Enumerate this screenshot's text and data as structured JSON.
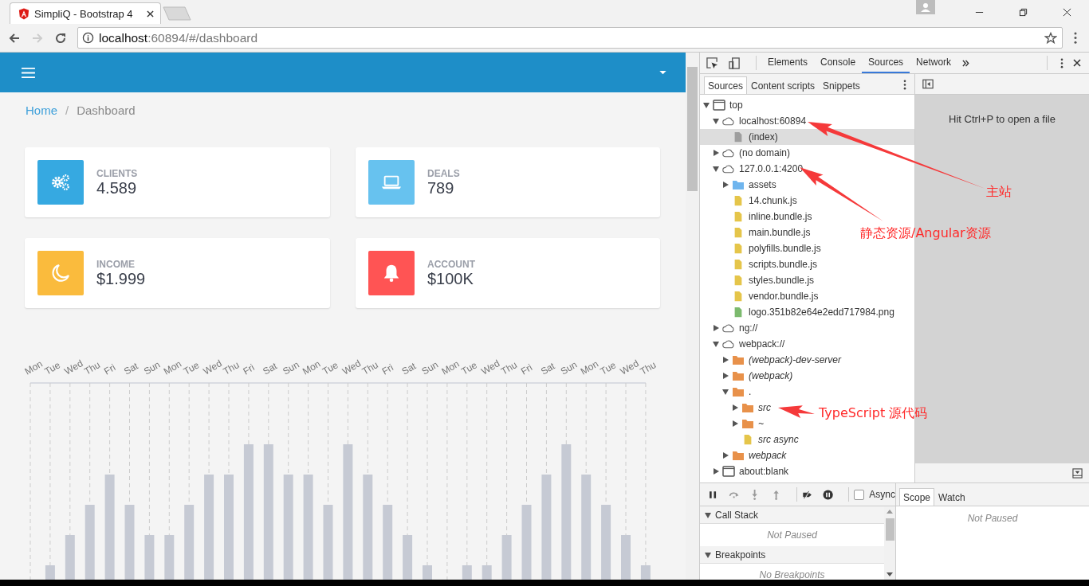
{
  "browser": {
    "tab": {
      "title": "SimpliQ - Bootstrap 4"
    },
    "address": {
      "host": "localhost",
      "rest": ":60894/#/dashboard"
    }
  },
  "page": {
    "breadcrumb": [
      {
        "label": "Home",
        "kind": "link"
      },
      {
        "label": "Dashboard",
        "kind": "current"
      }
    ],
    "breadcrumb_separator": "/",
    "stats": [
      {
        "label": "CLIENTS",
        "value": "4.589",
        "color": "#36a9e1",
        "kind": "gears"
      },
      {
        "label": "DEALS",
        "value": "789",
        "color": "#67c2ef",
        "kind": "laptop"
      },
      {
        "label": "INCOME",
        "value": "$1.999",
        "color": "#fabb3d",
        "kind": "moon"
      },
      {
        "label": "ACCOUNT",
        "value": "$100K",
        "color": "#ff5454",
        "kind": "bell"
      }
    ],
    "chart_labels": [
      "Mon",
      "Tue",
      "Wed",
      "Thu",
      "Fri",
      "Sat",
      "Sun",
      "Mon",
      "Tue",
      "Wed",
      "Thu",
      "Fri",
      "Sat",
      "Sun",
      "Mon",
      "Tue",
      "Wed",
      "Thu",
      "Fri",
      "Sat",
      "Sun",
      "Mon",
      "Tue",
      "Wed",
      "Thu",
      "Fri",
      "Sat",
      "Sun",
      "Mon",
      "Tue",
      "Wed",
      "Thu"
    ]
  },
  "devtools": {
    "tabs": [
      {
        "label": "Elements",
        "selected": false
      },
      {
        "label": "Console",
        "selected": false
      },
      {
        "label": "Sources",
        "selected": true
      },
      {
        "label": "Network",
        "selected": false
      }
    ],
    "navigator_tabs": [
      {
        "label": "Sources",
        "selected": true
      },
      {
        "label": "Content scripts",
        "selected": false
      },
      {
        "label": "Snippets",
        "selected": false
      }
    ],
    "tree": [
      {
        "label": "top",
        "kind": "frame",
        "expanded": true,
        "selected": false,
        "italic": false,
        "children": [
          {
            "label": "localhost:60894",
            "kind": "domain",
            "expanded": true,
            "selected": false,
            "italic": false,
            "children": [
              {
                "label": "(index)",
                "kind": "file",
                "color": "#9e9e9e",
                "selected": true,
                "italic": false
              }
            ]
          },
          {
            "label": "(no domain)",
            "kind": "domain",
            "expanded": false,
            "selected": false,
            "italic": false
          },
          {
            "label": "127.0.0.1:4200",
            "kind": "domain",
            "expanded": true,
            "selected": false,
            "italic": false,
            "children": [
              {
                "label": "assets",
                "kind": "folder",
                "color": "#6fb5ee",
                "expanded": false,
                "selected": false,
                "italic": false
              },
              {
                "label": "14.chunk.js",
                "kind": "file",
                "color": "#e5c54a",
                "selected": false,
                "italic": false
              },
              {
                "label": "inline.bundle.js",
                "kind": "file",
                "color": "#e5c54a",
                "selected": false,
                "italic": false
              },
              {
                "label": "main.bundle.js",
                "kind": "file",
                "color": "#e5c54a",
                "selected": false,
                "italic": false
              },
              {
                "label": "polyfills.bundle.js",
                "kind": "file",
                "color": "#e5c54a",
                "selected": false,
                "italic": false
              },
              {
                "label": "scripts.bundle.js",
                "kind": "file",
                "color": "#e5c54a",
                "selected": false,
                "italic": false
              },
              {
                "label": "styles.bundle.js",
                "kind": "file",
                "color": "#e5c54a",
                "selected": false,
                "italic": false
              },
              {
                "label": "vendor.bundle.js",
                "kind": "file",
                "color": "#e5c54a",
                "selected": false,
                "italic": false
              },
              {
                "label": "logo.351b82e64e2edd717984.png",
                "kind": "file",
                "color": "#7cba6e",
                "selected": false,
                "italic": false
              }
            ]
          },
          {
            "label": "ng://",
            "kind": "domain",
            "expanded": false,
            "selected": false,
            "italic": false
          },
          {
            "label": "webpack://",
            "kind": "domain",
            "expanded": true,
            "selected": false,
            "italic": false,
            "children": [
              {
                "label": "(webpack)-dev-server",
                "kind": "folder",
                "color": "#e8914a",
                "expanded": false,
                "selected": false,
                "italic": true
              },
              {
                "label": "(webpack)",
                "kind": "folder",
                "color": "#e8914a",
                "expanded": false,
                "selected": false,
                "italic": true
              },
              {
                "label": ".",
                "kind": "folder",
                "color": "#e8914a",
                "expanded": true,
                "selected": false,
                "italic": false,
                "children": [
                  {
                    "label": "src",
                    "kind": "folder",
                    "color": "#e8914a",
                    "expanded": false,
                    "selected": false,
                    "italic": true
                  },
                  {
                    "label": "~",
                    "kind": "folder",
                    "color": "#e8914a",
                    "expanded": false,
                    "selected": false,
                    "italic": true
                  },
                  {
                    "label": "src async",
                    "kind": "file",
                    "color": "#e5c54a",
                    "selected": false,
                    "italic": true
                  }
                ]
              },
              {
                "label": "webpack",
                "kind": "folder",
                "color": "#e8914a",
                "expanded": false,
                "selected": false,
                "italic": true
              }
            ]
          },
          {
            "label": "about:blank",
            "kind": "frame",
            "expanded": false,
            "selected": false,
            "italic": false
          }
        ]
      }
    ],
    "editor_hint": "Hit Ctrl+P to open a file",
    "debugger": {
      "async": {
        "label": "Async",
        "checked": false
      },
      "sections": [
        {
          "title": "Call Stack",
          "expanded": true,
          "message": "Not Paused"
        },
        {
          "title": "Breakpoints",
          "expanded": true,
          "message": "No Breakpoints"
        }
      ],
      "side_tabs": [
        {
          "label": "Scope",
          "selected": true
        },
        {
          "label": "Watch",
          "selected": false
        }
      ],
      "side_message": "Not Paused"
    }
  },
  "annotations": [
    {
      "text": "主站"
    },
    {
      "text": "静态资源/Angular资源"
    },
    {
      "text": "TypeScript 源代码"
    }
  ]
}
